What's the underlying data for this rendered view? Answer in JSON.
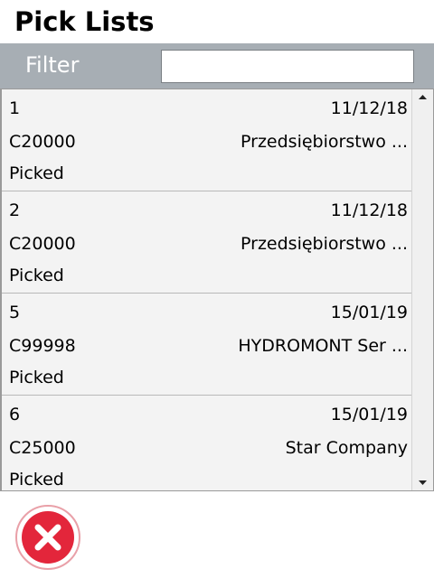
{
  "header": {
    "title": "Pick Lists"
  },
  "filter": {
    "label": "Filter",
    "value": "",
    "placeholder": ""
  },
  "list": {
    "items": [
      {
        "number": "1",
        "date": "11/12/18",
        "code": "C20000",
        "company": "Przedsiębiorstwo ...",
        "status": "Picked"
      },
      {
        "number": "2",
        "date": "11/12/18",
        "code": "C20000",
        "company": "Przedsiębiorstwo ...",
        "status": "Picked"
      },
      {
        "number": "5",
        "date": "15/01/19",
        "code": "C99998",
        "company": "HYDROMONT Ser ...",
        "status": "Picked"
      },
      {
        "number": "6",
        "date": "15/01/19",
        "code": "C25000",
        "company": "Star Company",
        "status": "Picked"
      }
    ]
  },
  "icons": {
    "close": "close-circle-icon",
    "scroll_up": "chevron-up-icon",
    "scroll_down": "chevron-down-icon"
  },
  "colors": {
    "filter_bar": "#a7aeb4",
    "close_red": "#e3263b",
    "list_bg": "#f3f3f3"
  }
}
